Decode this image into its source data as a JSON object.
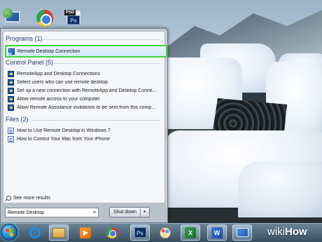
{
  "desktop": {
    "icons": [
      {
        "name": "Computer"
      },
      {
        "name": "Google Chrome"
      },
      {
        "name": "Photoshop PSD",
        "tag": "PSD",
        "badge": "Ps"
      }
    ]
  },
  "start_menu": {
    "sections": {
      "programs": "Programs (1)",
      "control_panel": "Control Panel (5)",
      "files": "Files (2)"
    },
    "programs": [
      {
        "label": "Remote Desktop Connection",
        "icon": "remote-desktop-icon",
        "highlighted": true
      }
    ],
    "control_panel": [
      {
        "label": "RemoteApp and Desktop Connections",
        "icon": "control-panel-icon"
      },
      {
        "label": "Select users who can use remote desktop",
        "icon": "control-panel-icon"
      },
      {
        "label": "Set up a new connection with RemoteApp and Desktop Conne...",
        "icon": "control-panel-icon"
      },
      {
        "label": "Allow remote access to your computer",
        "icon": "control-panel-icon"
      },
      {
        "label": "Allow Remote Assistance invitations to be sent from this comp...",
        "icon": "control-panel-icon"
      }
    ],
    "files": [
      {
        "label": "How to Use Remote Desktop in Windows 7",
        "icon": "document-icon"
      },
      {
        "label": "How to Control Your Mac from Your iPhone",
        "icon": "document-icon"
      }
    ],
    "see_more": "See more results",
    "search": {
      "value": "Remote Desktop",
      "clear": "×"
    },
    "shutdown": {
      "label": "Shut down",
      "arrow": "▸"
    },
    "highlight_color": "#3ed63a"
  },
  "taskbar": {
    "start": "Start",
    "items": [
      {
        "name": "Internet Explorer",
        "glyph": "e"
      },
      {
        "name": "Windows Explorer"
      },
      {
        "name": "Windows Media Player"
      },
      {
        "name": "Google Chrome"
      },
      {
        "name": "Adobe Photoshop",
        "glyph": "Ps"
      },
      {
        "name": "Paint"
      },
      {
        "name": "Microsoft Excel",
        "glyph": "X"
      },
      {
        "name": "Microsoft Word",
        "glyph": "W"
      },
      {
        "name": "Remote Desktop Connection"
      }
    ]
  },
  "watermark": {
    "wiki": "wiki",
    "how": "How"
  }
}
